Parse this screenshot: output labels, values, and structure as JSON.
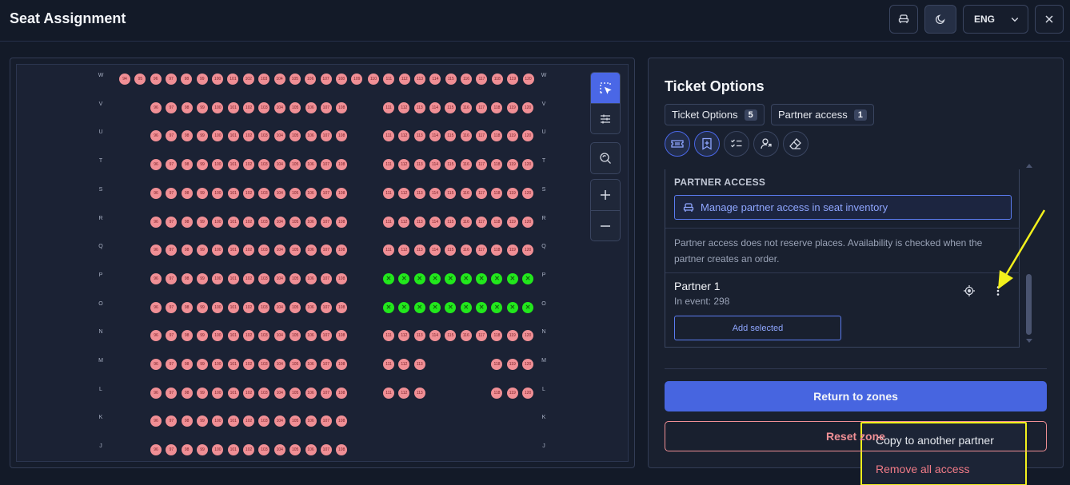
{
  "header": {
    "title": "Seat Assignment",
    "language": "ENG",
    "icons": [
      "seat-icon",
      "moon-icon",
      "chevron-down-icon",
      "close-icon"
    ]
  },
  "seat_map": {
    "available_color": "#f08f95",
    "selected_color": "#22e81c",
    "selected_glyph": "✕",
    "rows": [
      {
        "label": "W",
        "left": [
          94,
          95,
          96,
          97,
          98,
          99,
          100,
          101,
          102,
          103,
          104,
          105,
          106,
          107,
          108,
          109
        ],
        "right": [
          110,
          111,
          112,
          113,
          114,
          115,
          116,
          117,
          118,
          119,
          120
        ],
        "right_selected": false
      },
      {
        "label": "V",
        "left": [
          96,
          97,
          98,
          99,
          100,
          101,
          102,
          103,
          104,
          105,
          106,
          107,
          108
        ],
        "right": [
          111,
          112,
          113,
          114,
          115,
          116,
          117,
          118,
          119,
          120
        ],
        "right_selected": false
      },
      {
        "label": "U",
        "left": [
          96,
          97,
          98,
          99,
          100,
          101,
          102,
          103,
          104,
          105,
          106,
          107,
          108
        ],
        "right": [
          111,
          112,
          113,
          114,
          115,
          116,
          117,
          118,
          119,
          120
        ],
        "right_selected": false
      },
      {
        "label": "T",
        "left": [
          96,
          97,
          98,
          99,
          100,
          101,
          102,
          103,
          104,
          105,
          106,
          107,
          108
        ],
        "right": [
          111,
          112,
          113,
          114,
          115,
          116,
          117,
          118,
          119,
          120
        ],
        "right_selected": false
      },
      {
        "label": "S",
        "left": [
          96,
          97,
          98,
          99,
          100,
          101,
          102,
          103,
          104,
          105,
          106,
          107,
          108
        ],
        "right": [
          111,
          112,
          113,
          114,
          115,
          116,
          117,
          118,
          119,
          120
        ],
        "right_selected": false
      },
      {
        "label": "R",
        "left": [
          96,
          97,
          98,
          99,
          100,
          101,
          102,
          103,
          104,
          105,
          106,
          107,
          108
        ],
        "right": [
          111,
          112,
          113,
          114,
          115,
          116,
          117,
          118,
          119,
          120
        ],
        "right_selected": false
      },
      {
        "label": "Q",
        "left": [
          96,
          97,
          98,
          99,
          100,
          101,
          102,
          103,
          104,
          105,
          106,
          107,
          108
        ],
        "right": [
          111,
          112,
          113,
          114,
          115,
          116,
          117,
          118,
          119,
          120
        ],
        "right_selected": false
      },
      {
        "label": "P",
        "left": [
          96,
          97,
          98,
          99,
          100,
          101,
          102,
          103,
          104,
          105,
          106,
          107,
          108
        ],
        "right": [
          111,
          112,
          113,
          114,
          115,
          116,
          117,
          118,
          119,
          120
        ],
        "right_selected": true
      },
      {
        "label": "O",
        "left": [
          96,
          97,
          98,
          99,
          100,
          101,
          102,
          103,
          104,
          105,
          106,
          107,
          108
        ],
        "right": [
          111,
          112,
          113,
          114,
          115,
          116,
          117,
          118,
          119,
          120
        ],
        "right_selected": true
      },
      {
        "label": "N",
        "left": [
          96,
          97,
          98,
          99,
          100,
          101,
          102,
          103,
          104,
          105,
          106,
          107,
          108
        ],
        "right": [
          111,
          112,
          113,
          114,
          115,
          116,
          117,
          118,
          119,
          120
        ],
        "right_selected": false
      },
      {
        "label": "M",
        "left": [
          96,
          97,
          98,
          99,
          100,
          101,
          102,
          103,
          104,
          105,
          106,
          107,
          108
        ],
        "right": [
          111,
          112,
          113,
          null,
          null,
          null,
          null,
          118,
          119,
          120
        ],
        "right_selected": false
      },
      {
        "label": "L",
        "left": [
          96,
          97,
          98,
          99,
          100,
          101,
          102,
          103,
          104,
          105,
          106,
          107,
          108
        ],
        "right": [
          111,
          112,
          113,
          null,
          null,
          null,
          null,
          118,
          119,
          120
        ],
        "right_selected": false
      },
      {
        "label": "K",
        "left": [
          96,
          97,
          98,
          99,
          100,
          101,
          102,
          103,
          104,
          105,
          106,
          107,
          108
        ],
        "right": [],
        "right_selected": false
      },
      {
        "label": "J",
        "left": [
          96,
          97,
          98,
          99,
          100,
          101,
          102,
          103,
          104,
          105,
          106,
          107,
          108
        ],
        "right": [],
        "right_selected": false
      }
    ],
    "toolbar": [
      "select-area-icon",
      "sliders-icon",
      "zoom-reset-icon",
      "zoom-in-icon",
      "zoom-out-icon"
    ]
  },
  "panel": {
    "title": "Ticket Options",
    "tabs": [
      {
        "label": "Ticket Options",
        "count": "5"
      },
      {
        "label": "Partner access",
        "count": "1"
      }
    ],
    "tool_icons": [
      "ticket-icon",
      "bookmark-plus-icon",
      "checklist-icon",
      "user-share-icon",
      "eraser-icon"
    ],
    "section_label": "PARTNER ACCESS",
    "manage_label": "Manage partner access in seat inventory",
    "note": "Partner access does not reserve places. Availability is checked when the partner creates an order.",
    "partner": {
      "name": "Partner 1",
      "in_event": "In event: 298",
      "add_label": "Add selected"
    },
    "menu": {
      "copy_label": "Copy to another partner",
      "remove_label": "Remove all access"
    },
    "return_label": "Return to zones",
    "reset_label": "Reset zone"
  },
  "annotation": {
    "color": "#f2f01c"
  }
}
